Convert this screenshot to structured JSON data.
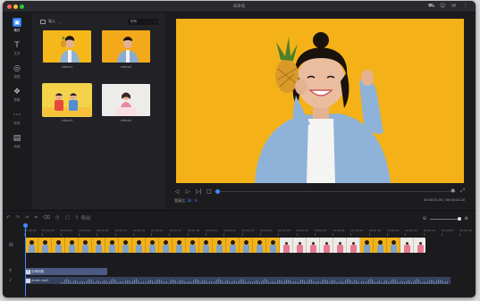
{
  "window": {
    "title": "未命名"
  },
  "titlebar_icons": [
    "cart-icon",
    "user-icon",
    "feedback-icon",
    "menu-icon"
  ],
  "sidebar": {
    "items": [
      {
        "label": "素材",
        "icon": "media-icon",
        "active": true
      },
      {
        "label": "文字",
        "icon": "text-icon",
        "active": false
      },
      {
        "label": "滤镜",
        "icon": "filter-icon",
        "active": false
      },
      {
        "label": "叠覆",
        "icon": "overlay-icon",
        "active": false
      },
      {
        "label": "转场",
        "icon": "transition-icon",
        "active": false
      },
      {
        "label": "动画",
        "icon": "animation-icon",
        "active": false
      }
    ]
  },
  "library": {
    "import_label": "导入",
    "filter_value": "所有",
    "items": [
      {
        "label": "video1",
        "style": "yellow-pineapple",
        "selected": false
      },
      {
        "label": "video2",
        "style": "yellow-girl",
        "selected": false
      },
      {
        "label": "video3",
        "style": "kids-yellow",
        "selected": true
      },
      {
        "label": "video4",
        "style": "white-girl",
        "selected": false
      }
    ]
  },
  "preview": {
    "ratio_label": "宽高比",
    "ratio_value": "16 : 9",
    "timecode": "00:00:01.00 / 00:00:20.20",
    "playhead_fraction": 0.01
  },
  "timeline": {
    "export_label": "导出",
    "zoom_fraction": 0.9,
    "ruler": [
      "00:00:00",
      "00:00:02",
      "00:00:04",
      "00:00:06",
      "00:00:08",
      "00:00:10",
      "00:00:12",
      "00:00:14",
      "00:00:16",
      "00:00:18",
      "00:00:20",
      "00:00:22",
      "00:00:24",
      "00:00:26",
      "00:00:28",
      "00:00:30",
      "00:00:32",
      "00:00:34",
      "00:00:36",
      "00:00:38",
      "00:00:40",
      "00:00:42",
      "00:00:44",
      "00:00:46",
      "00:00:48"
    ],
    "text_clip_label": "示例标题",
    "audio_clip_label": "music.mp3"
  }
}
